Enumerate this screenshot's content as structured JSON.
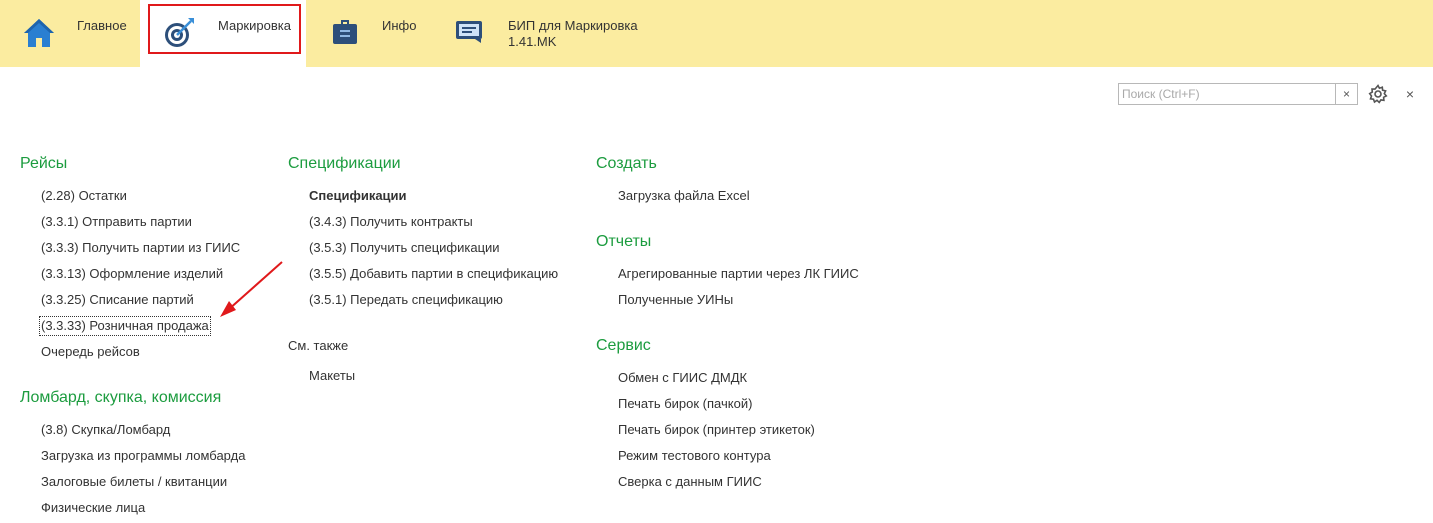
{
  "sections": [
    {
      "label": "Главное",
      "icon": "home-icon"
    },
    {
      "label": "Маркировка",
      "icon": "target-icon"
    },
    {
      "label": "Инфо",
      "icon": "info-briefcase-icon"
    },
    {
      "label": "БИП для Маркировка",
      "sublabel": "1.41.MK",
      "icon": "chat-window-icon"
    }
  ],
  "search": {
    "placeholder": "Поиск (Ctrl+F)",
    "clear": "×"
  },
  "toolbar": {
    "close": "×"
  },
  "col1": {
    "group1": {
      "title": "Рейсы",
      "items": [
        "(2.28) Остатки",
        "(3.3.1) Отправить партии",
        "(3.3.3) Получить партии из ГИИС",
        "(3.3.13) Оформление изделий",
        "(3.3.25) Списание партий",
        "(3.3.33) Розничная продажа",
        "Очередь рейсов"
      ]
    },
    "group2": {
      "title": "Ломбард, скупка, комиссия",
      "items": [
        "(3.8) Скупка/Ломбард",
        "Загрузка из программы ломбарда",
        "Залоговые билеты / квитанции",
        "Физические лица"
      ]
    }
  },
  "col2": {
    "group1": {
      "title": "Спецификации",
      "items": [
        "Спецификации",
        "(3.4.3) Получить контракты",
        "(3.5.3) Получить спецификации",
        "(3.5.5) Добавить партии в спецификацию",
        "(3.5.1) Передать спецификацию"
      ]
    },
    "see_also": {
      "title": "См. также",
      "items": [
        "Макеты"
      ]
    }
  },
  "col3": {
    "group1": {
      "title": "Создать",
      "items": [
        "Загрузка файла Excel"
      ]
    },
    "group2": {
      "title": "Отчеты",
      "items": [
        "Агрегированные партии через ЛК ГИИС",
        "Полученные УИНы"
      ]
    },
    "group3": {
      "title": "Сервис",
      "items": [
        "Обмен с ГИИС ДМДК",
        "Печать бирок (пачкой)",
        "Печать бирок (принтер этикеток)",
        "Режим тестового контура",
        "Сверка с данным ГИИС"
      ]
    }
  },
  "colors": {
    "topbar": "#fbeca0",
    "group_title": "#1c9c3f",
    "highlight": "#e0191b"
  }
}
